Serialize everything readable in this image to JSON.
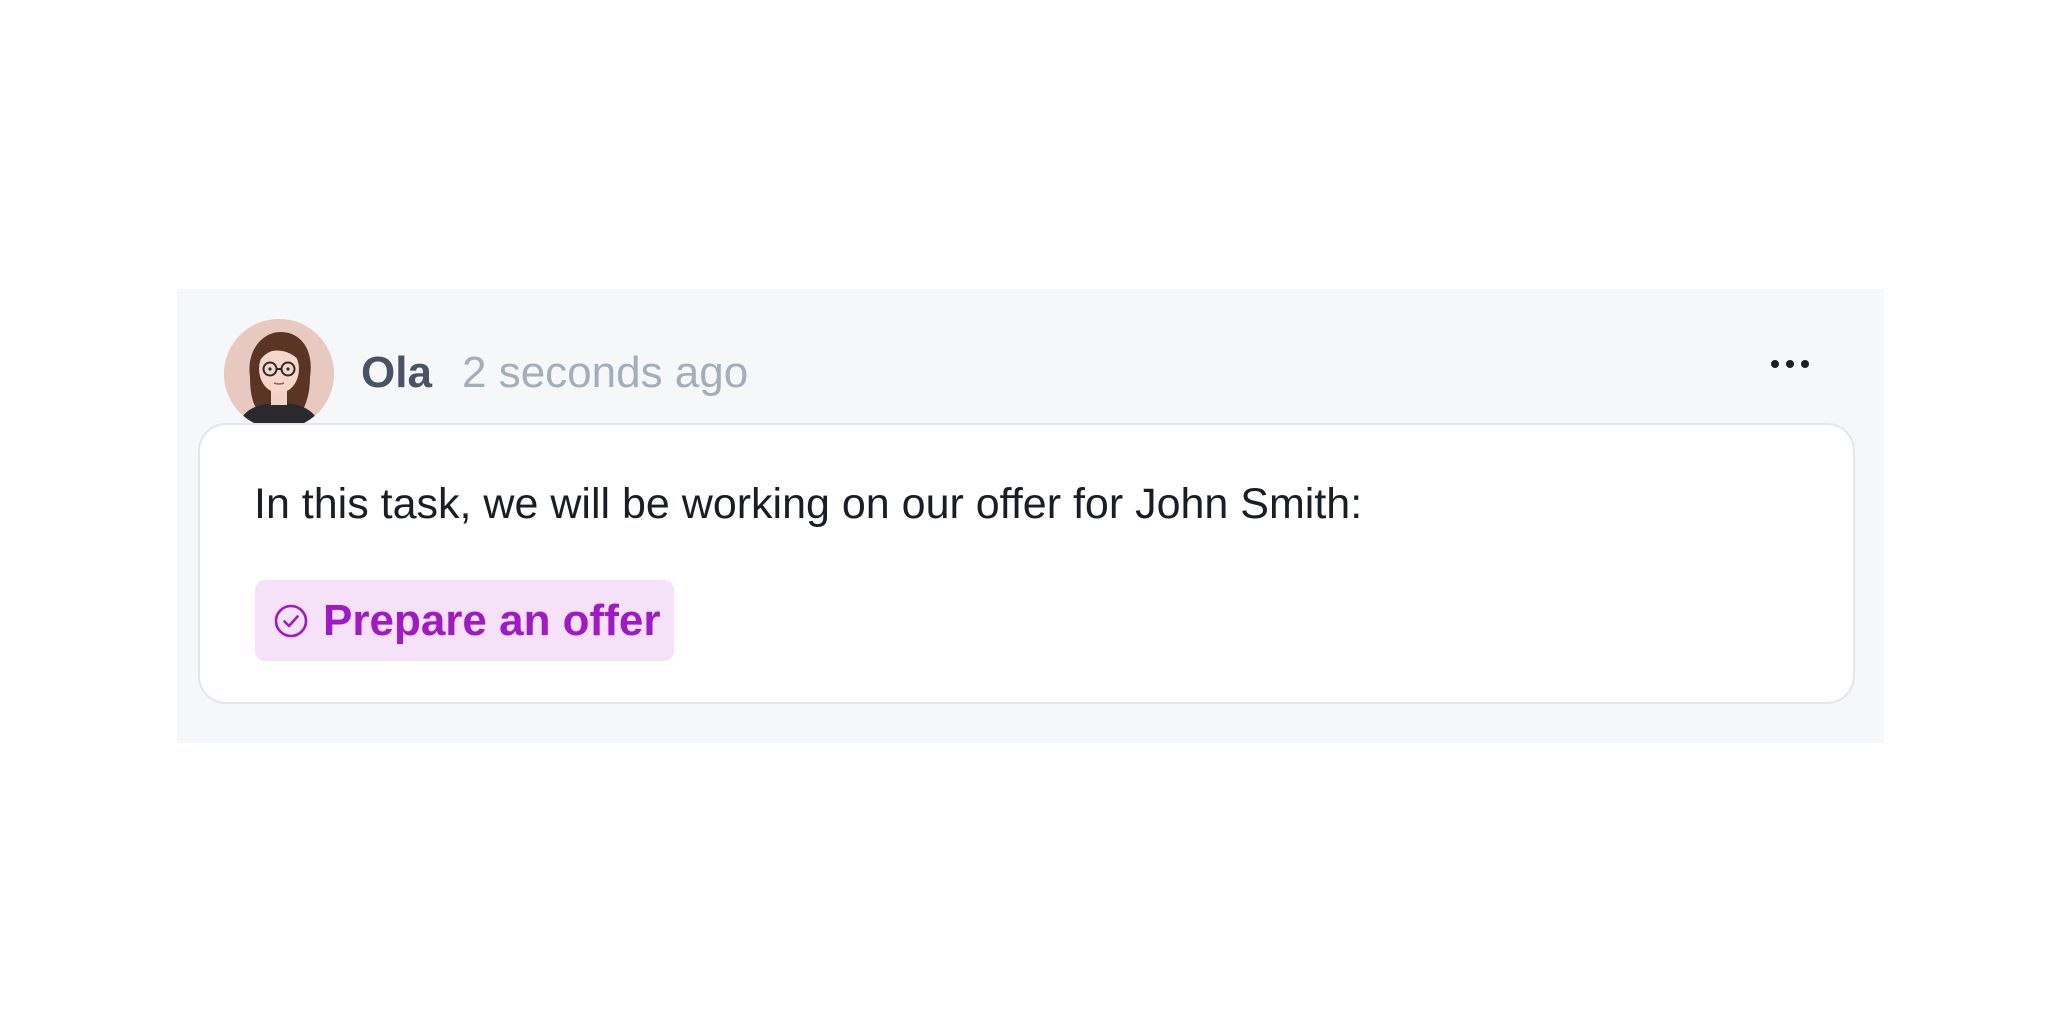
{
  "comment": {
    "author": {
      "name": "Ola",
      "avatar_icon": "user-avatar-illustration"
    },
    "timestamp": "2 seconds ago",
    "more_icon": "more-horizontal-icon",
    "body": "In this task, we will be working on our offer for John Smith:",
    "task_link": {
      "icon": "check-circle-icon",
      "label": "Prepare an offer",
      "color": "#a118c9",
      "background": "#f5e2f8"
    }
  },
  "colors": {
    "block_background": "#f6f7f9",
    "card_border": "#e2e5ea",
    "author_text": "#4a5365",
    "timestamp_text": "#a3aebc"
  }
}
